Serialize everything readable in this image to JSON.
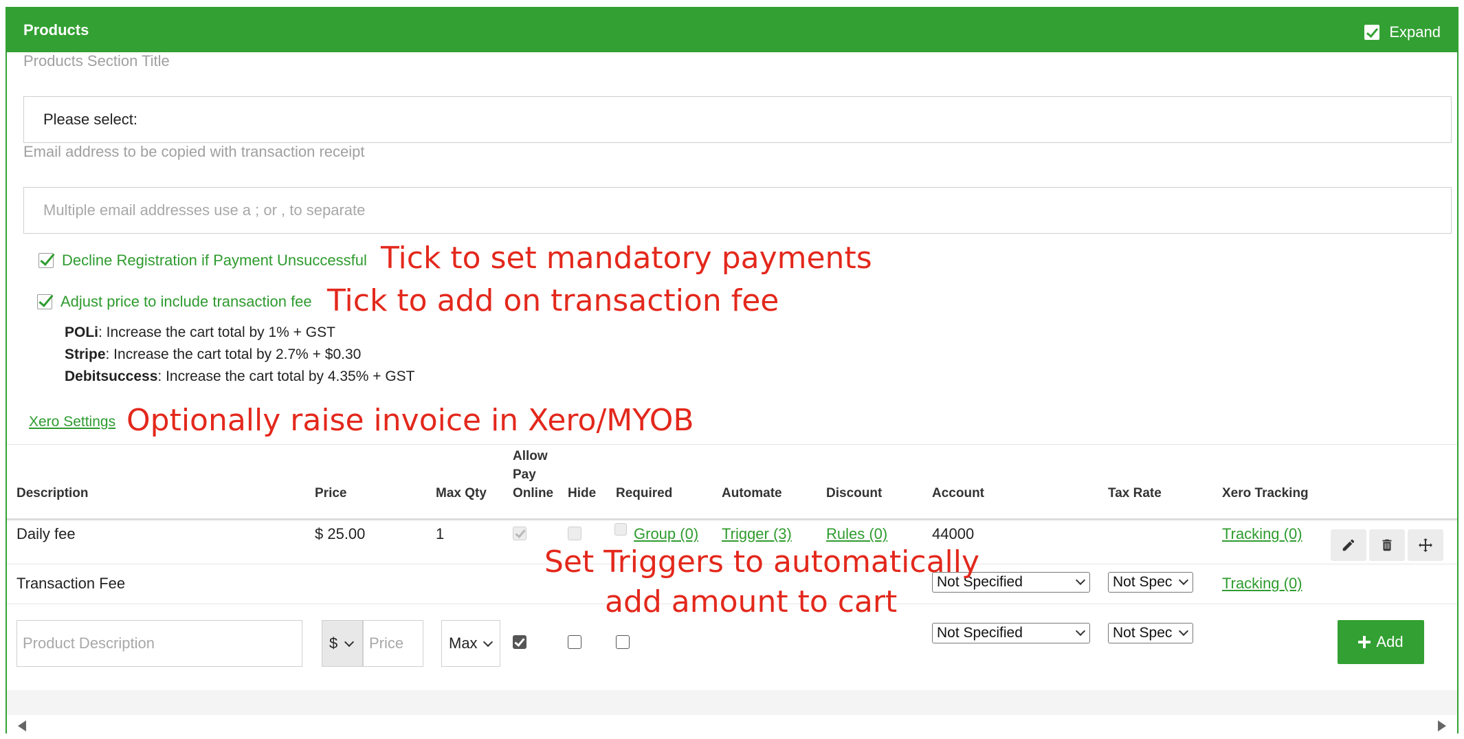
{
  "header": {
    "title": "Products",
    "expand_label": "Expand"
  },
  "section_title": {
    "label": "Products Section Title",
    "value": "Please select:"
  },
  "email": {
    "label": "Email address to be copied with transaction receipt",
    "placeholder": "Multiple email addresses use a ; or , to separate"
  },
  "options": {
    "decline_label": "Decline Registration if Payment Unsuccessful",
    "adjust_label": "Adjust price to include transaction fee"
  },
  "fees": [
    {
      "provider": "POLi",
      "text": ": Increase the cart total by 1% + GST"
    },
    {
      "provider": "Stripe",
      "text": ": Increase the cart total by 2.7% + $0.30"
    },
    {
      "provider": "Debitsuccess",
      "text": ": Increase the cart total by 4.35% + GST"
    }
  ],
  "xero_link": "Xero Settings",
  "annotations": {
    "mandatory": "Tick to set mandatory payments",
    "fee": "Tick to add on transaction fee",
    "xero": "Optionally raise invoice in Xero/MYOB",
    "triggers_1": "Set Triggers to automatically",
    "triggers_2": "add amount to cart"
  },
  "table": {
    "headers": {
      "description": "Description",
      "price": "Price",
      "max_qty": "Max Qty",
      "allow_1": "Allow",
      "allow_2": "Pay",
      "allow_3": "Online",
      "hide": "Hide",
      "required": "Required",
      "automate": "Automate",
      "discount": "Discount",
      "account": "Account",
      "tax_rate": "Tax Rate",
      "xero_tracking": "Xero Tracking"
    },
    "rows": [
      {
        "description": "Daily fee",
        "price": "$ 25.00",
        "max_qty": "1",
        "required": "Group (0)",
        "automate": "Trigger (3)",
        "discount": "Rules (0)",
        "account": "44000",
        "tracking": "Tracking (0)"
      },
      {
        "description": "Transaction Fee",
        "account": "Not Specified",
        "tax_rate": "Not Spec",
        "tracking": "Tracking (0)"
      }
    ],
    "new_row": {
      "description_placeholder": "Product Description",
      "currency": "$",
      "price_placeholder": "Price",
      "max_qty": "Max",
      "account": "Not Specified",
      "tax_rate": "Not Spec",
      "add_label": "Add"
    }
  },
  "colors": {
    "brand_green": "#33a033",
    "annotation_red": "#e3281c"
  },
  "icons": [
    "check-icon",
    "pencil-icon",
    "trash-icon",
    "move-icon",
    "plus-icon",
    "chevron-down-icon",
    "arrow-left-icon",
    "arrow-right-icon"
  ]
}
